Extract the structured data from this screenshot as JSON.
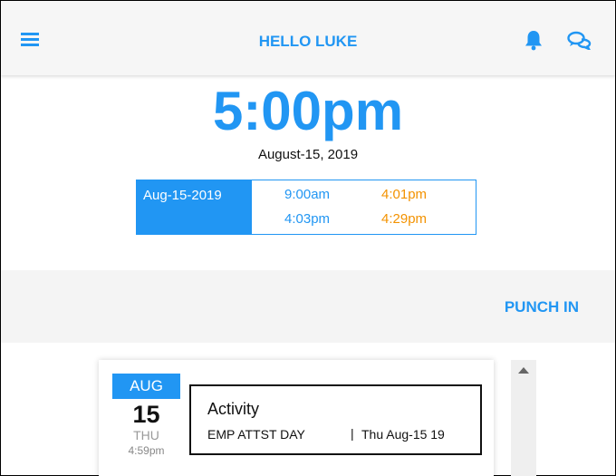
{
  "header": {
    "title": "HELLO LUKE",
    "menu_icon": "hamburger-menu-icon",
    "notification_icon": "bell-icon",
    "chat_icon": "chat-bubbles-icon"
  },
  "clock": {
    "time": "5:00pm",
    "date": "August-15, 2019"
  },
  "punches": {
    "date": "Aug-15-2019",
    "rows": [
      {
        "in": "9:00am",
        "out": "4:01pm"
      },
      {
        "in": "4:03pm",
        "out": "4:29pm"
      }
    ]
  },
  "actions": {
    "punch_in_label": "PUNCH IN"
  },
  "activities": [
    {
      "month": "AUG",
      "day": "15",
      "weekday": "THU",
      "time": "4:59pm",
      "title": "Activity",
      "code": "EMP ATTST DAY",
      "separator": "|",
      "date_label": "Thu Aug-15 19"
    }
  ],
  "colors": {
    "accent": "#2196f3",
    "punch_out": "#f39200"
  }
}
